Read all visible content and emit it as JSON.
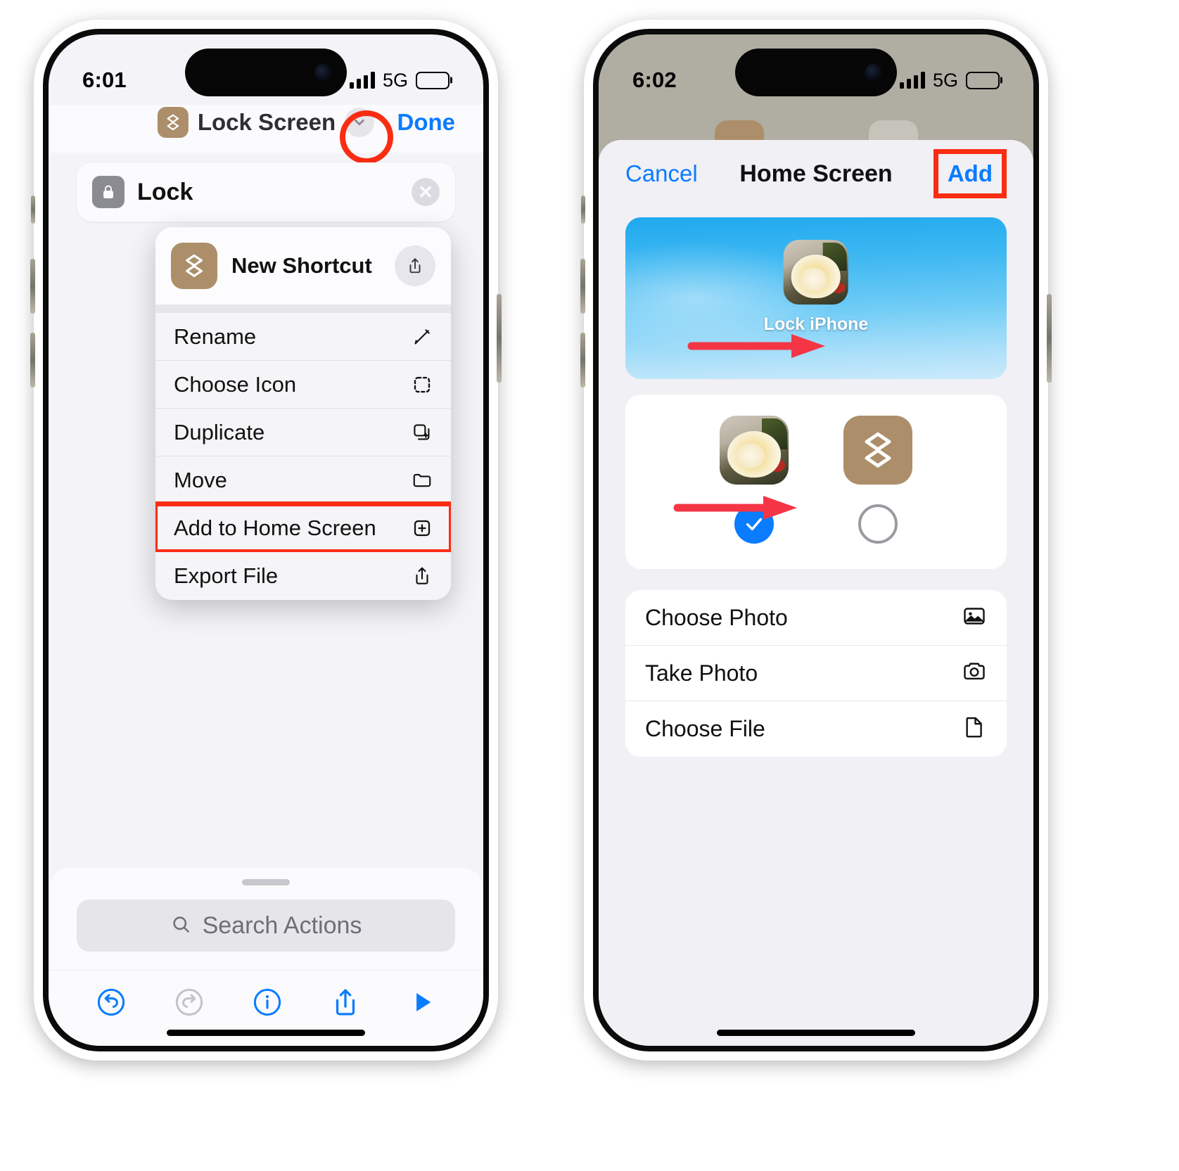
{
  "screens": [
    {
      "id": "shortcut-editor",
      "status": {
        "time": "6:01",
        "network": "5G",
        "battery_level": 40
      },
      "nav": {
        "title": "Lock Screen",
        "title_icon": "shortcuts-app-icon",
        "chevron_icon": "chevron-down-icon",
        "done_label": "Done"
      },
      "action_card": {
        "label": "Lock",
        "icon": "lock-icon",
        "close_icon": "close-circle-icon"
      },
      "context_menu": {
        "header": {
          "label": "New Shortcut",
          "icon": "shortcuts-app-icon",
          "share_icon": "share-icon"
        },
        "items": [
          {
            "label": "Rename",
            "icon": "pencil-icon",
            "highlighted": false
          },
          {
            "label": "Choose Icon",
            "icon": "dashed-square-icon",
            "highlighted": false
          },
          {
            "label": "Duplicate",
            "icon": "duplicate-icon",
            "highlighted": false
          },
          {
            "label": "Move",
            "icon": "folder-icon",
            "highlighted": false
          },
          {
            "label": "Add to Home Screen",
            "icon": "plus-square-icon",
            "highlighted": true
          },
          {
            "label": "Export File",
            "icon": "share-icon",
            "highlighted": false
          }
        ]
      },
      "search": {
        "placeholder": "Search Actions",
        "icon": "search-icon"
      },
      "toolbar": [
        {
          "name": "undo-button",
          "icon": "undo-icon",
          "state": "enabled"
        },
        {
          "name": "redo-button",
          "icon": "redo-icon",
          "state": "disabled"
        },
        {
          "name": "info-button",
          "icon": "info-circle-icon",
          "state": "enabled"
        },
        {
          "name": "share-button",
          "icon": "share-icon",
          "state": "enabled"
        },
        {
          "name": "play-button",
          "icon": "play-icon",
          "state": "enabled"
        }
      ]
    },
    {
      "id": "home-screen-sheet",
      "status": {
        "time": "6:02",
        "network": "5G",
        "battery_level": 40
      },
      "nav": {
        "cancel_label": "Cancel",
        "title": "Home Screen",
        "add_label": "Add"
      },
      "wallpaper_preview": {
        "app_label": "Lock iPhone",
        "icon": "rose-photo-icon"
      },
      "icon_options": [
        {
          "name": "photo-icon-option",
          "icon": "rose-photo-icon",
          "selected": true
        },
        {
          "name": "shortcut-icon-option",
          "icon": "shortcuts-app-icon",
          "selected": false
        }
      ],
      "menu_rows": [
        {
          "label": "Choose Photo",
          "icon": "photo-icon"
        },
        {
          "label": "Take Photo",
          "icon": "camera-icon"
        },
        {
          "label": "Choose File",
          "icon": "document-icon"
        }
      ]
    }
  ],
  "annotations": {
    "highlight_color": "#fa2d13",
    "arrow_color": "#f43545"
  }
}
